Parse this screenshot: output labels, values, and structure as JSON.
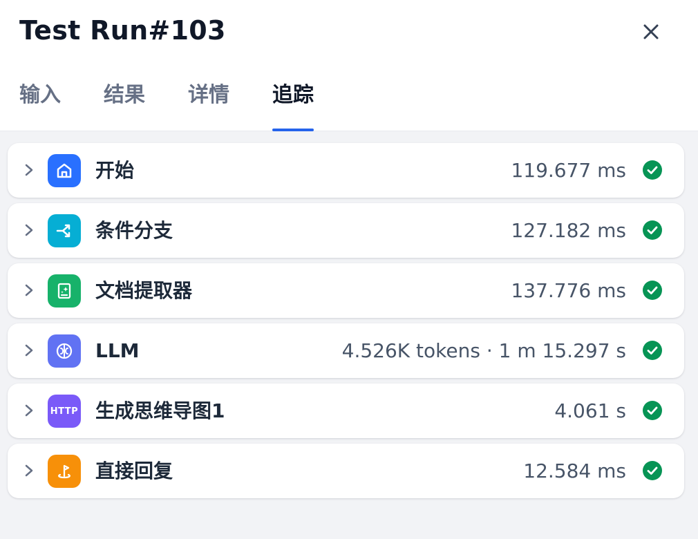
{
  "header": {
    "title": "Test Run#103",
    "close_icon": "close-icon"
  },
  "tabs": [
    {
      "label": "输入",
      "active": false
    },
    {
      "label": "结果",
      "active": false
    },
    {
      "label": "详情",
      "active": false
    },
    {
      "label": "追踪",
      "active": true
    }
  ],
  "colors": {
    "accent": "#2563eb",
    "success": "#079455"
  },
  "nodes": [
    {
      "name": "开始",
      "metric": "119.677 ms",
      "icon": "home-icon",
      "icon_color": "#2970ff",
      "status": "success"
    },
    {
      "name": "条件分支",
      "metric": "127.182 ms",
      "icon": "branch-icon",
      "icon_color": "#06aed4",
      "status": "success"
    },
    {
      "name": "文档提取器",
      "metric": "137.776 ms",
      "icon": "document-icon",
      "icon_color": "#17b26a",
      "status": "success"
    },
    {
      "name": "LLM",
      "metric": "4.526K tokens · 1 m 15.297 s",
      "icon": "brain-icon",
      "icon_color": "#6172f3",
      "status": "success"
    },
    {
      "name": "生成思维导图1",
      "metric": "4.061 s",
      "icon": "http-icon",
      "icon_label": "HTTP",
      "icon_color": "#7a5af8",
      "status": "success"
    },
    {
      "name": "直接回复",
      "metric": "12.584 ms",
      "icon": "reply-icon",
      "icon_color": "#f79009",
      "status": "success"
    }
  ]
}
